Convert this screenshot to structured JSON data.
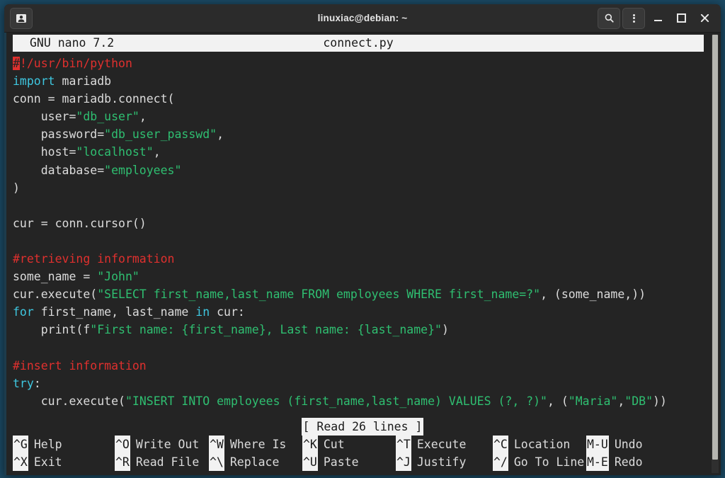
{
  "window": {
    "title": "linuxiac@debian: ~",
    "app_icon": "terminal-icon",
    "buttons": {
      "search": "search-icon",
      "menu": "kebab-menu-icon",
      "minimize": "minimize-icon",
      "maximize": "maximize-icon",
      "close": "close-icon"
    }
  },
  "nano": {
    "version_label": "GNU nano 7.2",
    "filename": "connect.py",
    "status_message": "[ Read 26 lines ]",
    "lines": [
      [
        {
          "t": "#",
          "c": "cursor"
        },
        {
          "t": "!/usr/bin/python",
          "c": "comment"
        }
      ],
      [
        {
          "t": "import",
          "c": "keyword"
        },
        {
          "t": " mariadb",
          "c": "plain"
        }
      ],
      [
        {
          "t": "conn = mariadb.connect(",
          "c": "plain"
        }
      ],
      [
        {
          "t": "    user=",
          "c": "plain"
        },
        {
          "t": "\"db_user\"",
          "c": "string"
        },
        {
          "t": ",",
          "c": "plain"
        }
      ],
      [
        {
          "t": "    password=",
          "c": "plain"
        },
        {
          "t": "\"db_user_passwd\"",
          "c": "string"
        },
        {
          "t": ",",
          "c": "plain"
        }
      ],
      [
        {
          "t": "    host=",
          "c": "plain"
        },
        {
          "t": "\"localhost\"",
          "c": "string"
        },
        {
          "t": ",",
          "c": "plain"
        }
      ],
      [
        {
          "t": "    database=",
          "c": "plain"
        },
        {
          "t": "\"employees\"",
          "c": "string"
        }
      ],
      [
        {
          "t": ")",
          "c": "plain"
        }
      ],
      [],
      [
        {
          "t": "cur = conn.cursor()",
          "c": "plain"
        }
      ],
      [],
      [
        {
          "t": "#retrieving information",
          "c": "comment"
        }
      ],
      [
        {
          "t": "some_name = ",
          "c": "plain"
        },
        {
          "t": "\"John\"",
          "c": "string"
        }
      ],
      [
        {
          "t": "cur.execute(",
          "c": "plain"
        },
        {
          "t": "\"SELECT first_name,last_name FROM employees WHERE first_name=?\"",
          "c": "string"
        },
        {
          "t": ", (some_name,))",
          "c": "plain"
        }
      ],
      [
        {
          "t": "for",
          "c": "keyword"
        },
        {
          "t": " first_name, last_name ",
          "c": "plain"
        },
        {
          "t": "in",
          "c": "keyword"
        },
        {
          "t": " cur:",
          "c": "plain"
        }
      ],
      [
        {
          "t": "    print(f",
          "c": "plain"
        },
        {
          "t": "\"First name: {first_name}, Last name: {last_name}\"",
          "c": "string"
        },
        {
          "t": ")",
          "c": "plain"
        }
      ],
      [],
      [
        {
          "t": "#insert information",
          "c": "comment"
        }
      ],
      [
        {
          "t": "try",
          "c": "keyword"
        },
        {
          "t": ":",
          "c": "plain"
        }
      ],
      [
        {
          "t": "    cur.execute(",
          "c": "plain"
        },
        {
          "t": "\"INSERT INTO employees (first_name,last_name) VALUES (?, ?)\"",
          "c": "string"
        },
        {
          "t": ", (",
          "c": "plain"
        },
        {
          "t": "\"Maria\"",
          "c": "string"
        },
        {
          "t": ",",
          "c": "plain"
        },
        {
          "t": "\"DB\"",
          "c": "string"
        },
        {
          "t": "))",
          "c": "plain"
        }
      ]
    ],
    "shortcuts": {
      "row1": [
        {
          "key": "^G",
          "label": "Help"
        },
        {
          "key": "^O",
          "label": "Write Out"
        },
        {
          "key": "^W",
          "label": "Where Is"
        },
        {
          "key": "^K",
          "label": "Cut"
        },
        {
          "key": "^T",
          "label": "Execute"
        },
        {
          "key": "^C",
          "label": "Location"
        },
        {
          "key": "M-U",
          "label": "Undo"
        }
      ],
      "row2": [
        {
          "key": "^X",
          "label": "Exit"
        },
        {
          "key": "^R",
          "label": "Read File"
        },
        {
          "key": "^\\",
          "label": "Replace"
        },
        {
          "key": "^U",
          "label": "Paste"
        },
        {
          "key": "^J",
          "label": "Justify"
        },
        {
          "key": "^/",
          "label": "Go To Line"
        },
        {
          "key": "M-E",
          "label": "Redo"
        }
      ]
    }
  },
  "colors": {
    "desktop": "#1b4963",
    "titlebar": "#2b2b2b",
    "terminal_bg": "#242424",
    "comment": "#e0302e",
    "keyword": "#3ec7e0",
    "string": "#2fbf71",
    "plain": "#dcdcdc",
    "inverted_bg": "#f2f2f2"
  }
}
